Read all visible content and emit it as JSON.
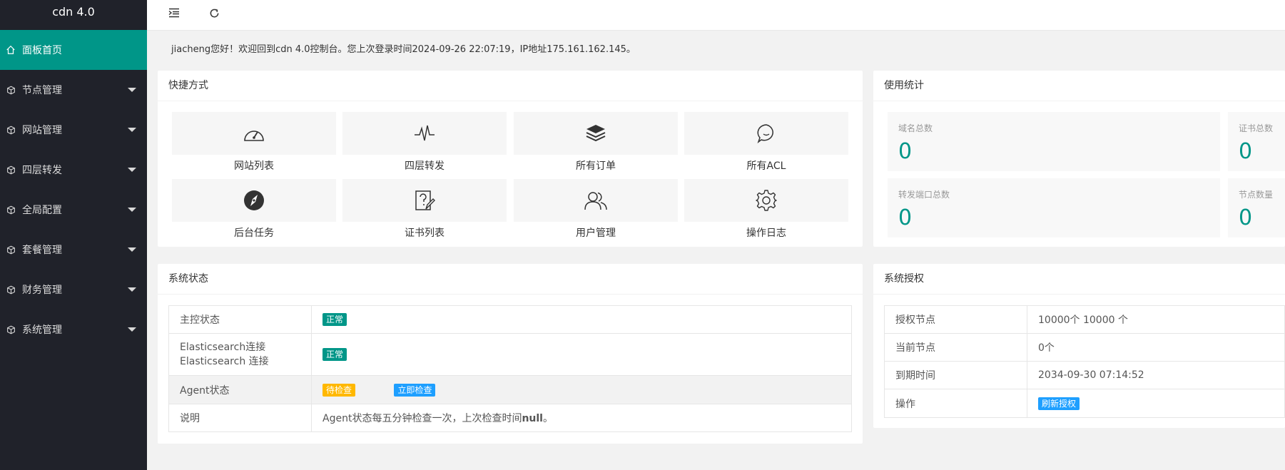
{
  "app": {
    "title": "cdn 4.0"
  },
  "sidebar": {
    "items": [
      {
        "label": "面板首页"
      },
      {
        "label": "节点管理"
      },
      {
        "label": "网站管理"
      },
      {
        "label": "四层转发"
      },
      {
        "label": "全局配置"
      },
      {
        "label": "套餐管理"
      },
      {
        "label": "财务管理"
      },
      {
        "label": "系统管理"
      }
    ]
  },
  "welcome": {
    "text": "jiacheng您好！欢迎回到cdn 4.0控制台。您上次登录时间2024-09-26 22:07:19，IP地址175.161.162.145。"
  },
  "shortcuts": {
    "title": "快捷方式",
    "items": [
      {
        "label": "网站列表",
        "icon": "gauge-icon"
      },
      {
        "label": "四层转发",
        "icon": "pulse-icon"
      },
      {
        "label": "所有订单",
        "icon": "layers-icon"
      },
      {
        "label": "所有ACL",
        "icon": "chat-icon"
      },
      {
        "label": "后台任务",
        "icon": "compass-icon"
      },
      {
        "label": "证书列表",
        "icon": "help-edit-icon"
      },
      {
        "label": "用户管理",
        "icon": "users-icon"
      },
      {
        "label": "操作日志",
        "icon": "gear-icon"
      }
    ]
  },
  "stats": {
    "title": "使用统计",
    "items": [
      {
        "label": "域名总数",
        "value": "0"
      },
      {
        "label": "证书总数",
        "value": "0"
      },
      {
        "label": "转发端口总数",
        "value": "0"
      },
      {
        "label": "节点数量",
        "value": "0"
      }
    ]
  },
  "system_status": {
    "title": "系统状态",
    "rows": [
      {
        "label": "主控状态",
        "badge": "正常"
      },
      {
        "label": "Elasticsearch连接 Elasticsearch 连接",
        "badge": "正常"
      },
      {
        "label": "Agent状态",
        "badge": "待检查",
        "button": "立即检查"
      },
      {
        "label": "说明",
        "text_prefix": "Agent状态每五分钟检查一次，上次检查时间",
        "text_bold": "null",
        "text_suffix": "。"
      }
    ]
  },
  "license": {
    "title": "系统授权",
    "rows": [
      {
        "label": "授权节点",
        "value": "10000个 10000 个"
      },
      {
        "label": "当前节点",
        "value": "0个"
      },
      {
        "label": "到期时间",
        "value": "2034-09-30 07:14:52"
      },
      {
        "label": "操作",
        "button": "刷新授权"
      }
    ]
  },
  "colors": {
    "accent": "#009688",
    "sidebar": "#20222a",
    "warning": "#ffb800",
    "info": "#1e9fff"
  }
}
